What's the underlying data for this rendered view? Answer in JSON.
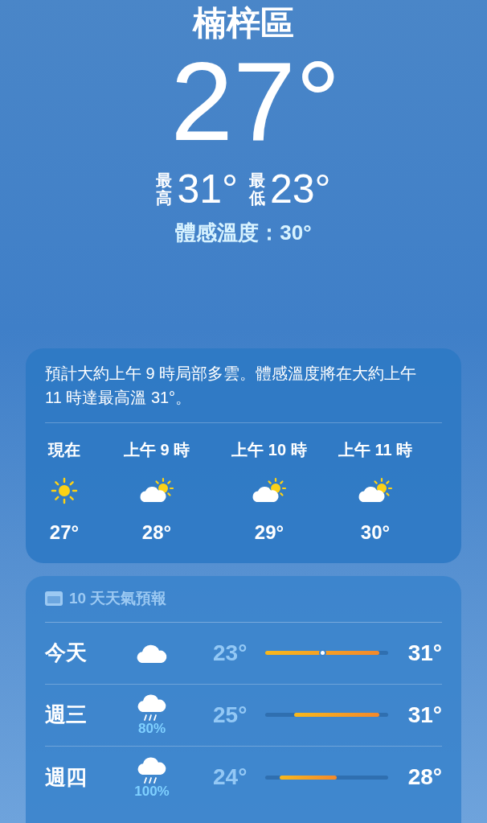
{
  "location": "楠梓區",
  "temperature": "27°",
  "high": {
    "label": "最高",
    "value": "31°"
  },
  "low": {
    "label": "最低",
    "value": "23°"
  },
  "feels_like": "體感溫度：30°",
  "hourly": {
    "summary": "預計大約上午 9 時局部多雲。體感溫度將在大約上午 11 時達最高溫 31°。",
    "hours": [
      {
        "time": "現在",
        "kind": "sun",
        "temp": "27°"
      },
      {
        "time": "上午 9 時",
        "kind": "partly_cloudy",
        "temp": "28°"
      },
      {
        "time": "上午 10 時",
        "kind": "partly_cloudy",
        "temp": "29°"
      },
      {
        "time": "上午 11 時",
        "kind": "partly_cloudy",
        "temp": "30°"
      }
    ]
  },
  "forecast": {
    "title": "10 天天氣預報",
    "days": [
      {
        "day": "今天",
        "kind": "cloud",
        "low": "23°",
        "high": "31°",
        "now_marker": true
      },
      {
        "day": "週三",
        "kind": "rain",
        "precip": "80%",
        "low": "25°",
        "high": "31°",
        "now_marker": false
      },
      {
        "day": "週四",
        "kind": "rain",
        "precip": "100%",
        "low": "24°",
        "high": "28°",
        "now_marker": false
      }
    ]
  }
}
